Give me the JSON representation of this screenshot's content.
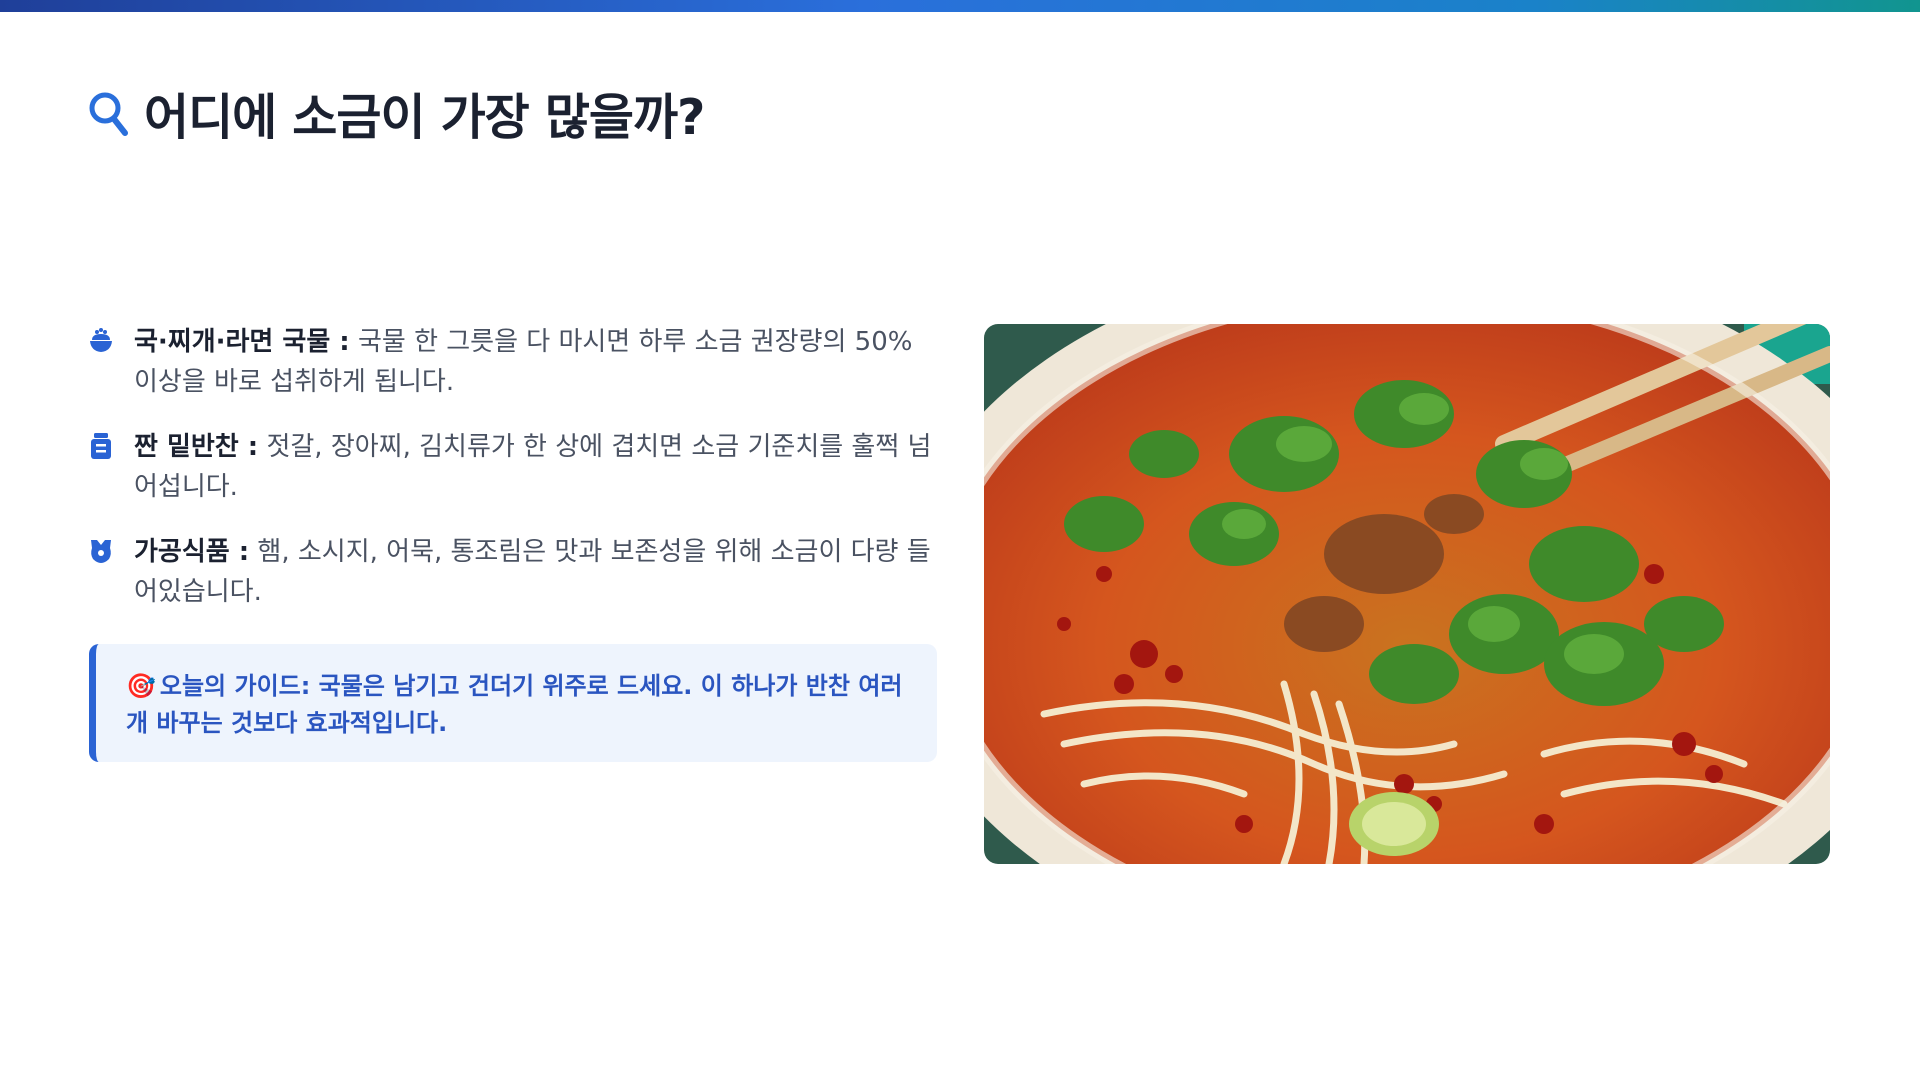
{
  "header": {
    "title": "어디에 소금이 가장 많을까?",
    "icon": "search-icon",
    "accent_color": "#2a6fdb"
  },
  "bullets": [
    {
      "icon": "rice-bowl-icon",
      "head": "국·찌개·라면 국물 :",
      "body": " 국물 한 그릇을 다 마시면 하루 소금 권장량의 50% 이상을 바로 섭취하게 됩니다."
    },
    {
      "icon": "jar-icon",
      "head": "짠 밑반찬 :",
      "body": " 젓갈, 장아찌, 김치류가 한 상에 겹치면 소금 기준치를 훌쩍 넘어섭니다."
    },
    {
      "icon": "can-icon",
      "head": "가공식품 :",
      "body": " 햄, 소시지, 어묵, 통조림은 맛과 보존성을 위해 소금이 다량 들어있습니다."
    }
  ],
  "guide": {
    "icon": "🎯",
    "text": "오늘의 가이드: 국물은 남기고 건더기 위주로 드세요. 이 하나가 반찬 여러 개 바꾸는 것보다 효과적입니다."
  },
  "photo": {
    "subject": "noodle-soup-bowl"
  }
}
